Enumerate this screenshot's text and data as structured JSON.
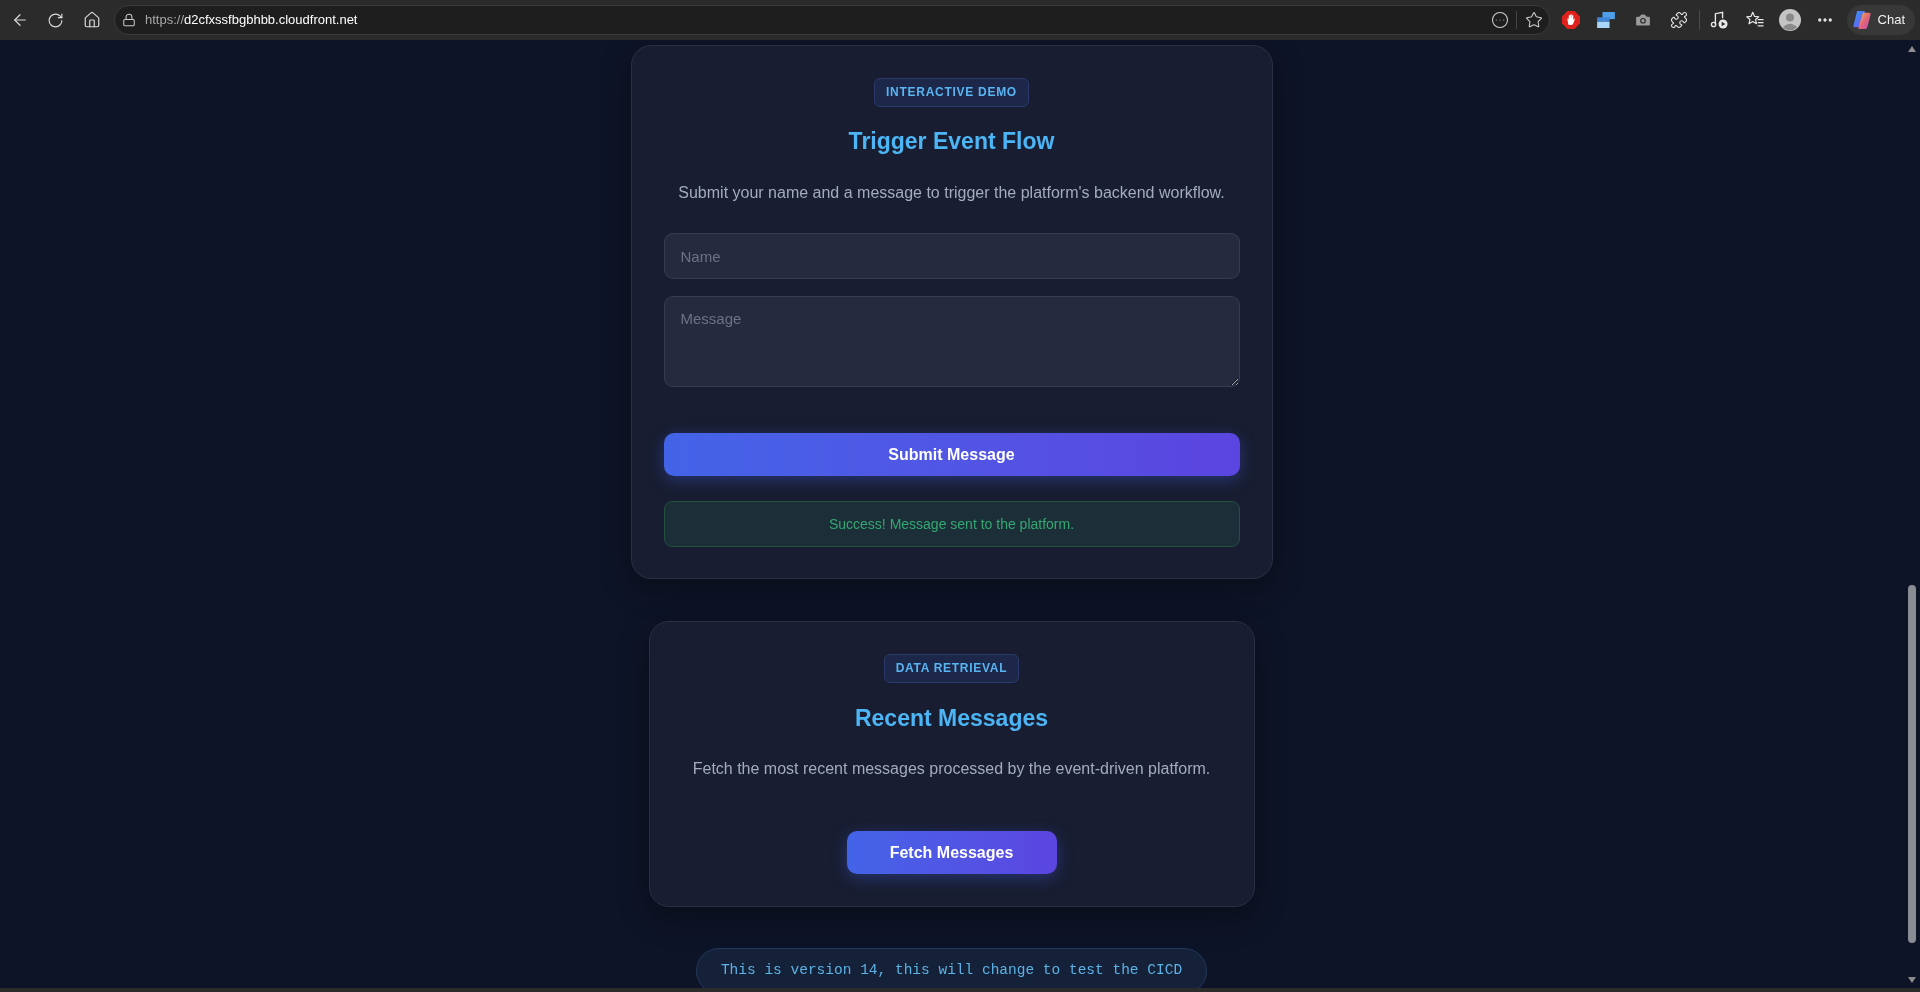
{
  "browser": {
    "url": {
      "scheme": "https://",
      "host": "d2cfxssfbgbhbb.cloudfront.net"
    },
    "chat_button": "Chat"
  },
  "trigger_card": {
    "tag": "INTERACTIVE DEMO",
    "title": "Trigger Event Flow",
    "description": "Submit your name and a message to trigger the platform's backend workflow.",
    "fields": [
      {
        "kind": "input",
        "placeholder": "Name"
      },
      {
        "kind": "textarea",
        "placeholder": "Message"
      }
    ],
    "button": "Submit Message",
    "status": {
      "kind": "success",
      "text": "Success! Message sent to the platform."
    }
  },
  "messages_card": {
    "tag": "DATA RETRIEVAL",
    "title": "Recent Messages",
    "description": "Fetch the most recent messages processed by the event-driven platform.",
    "button": "Fetch Messages"
  },
  "footer": "This is version 14, this will change to test the CICD"
}
